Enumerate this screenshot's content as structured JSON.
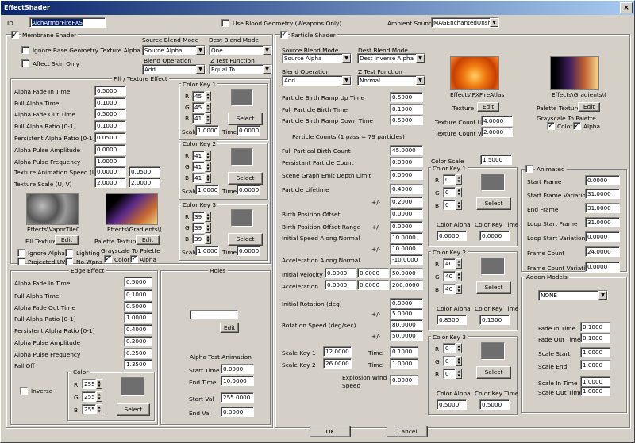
{
  "window": {
    "title": "EffectShader",
    "close": "×"
  },
  "top": {
    "id_label": "ID",
    "id_value": "AlchArmorFireFXS",
    "blood_label": "Use Blood Geometry (Weapons Only)",
    "ambient_label": "Ambient Sound",
    "ambient_value": "MAGEnchantedUnshea"
  },
  "membrane": {
    "title": "Membrane Shader",
    "ignore_base": "Ignore Base Geometry Texture Alpha",
    "affect_skin": "Affect Skin Only",
    "src_blend_label": "Source Blend Mode",
    "src_blend": "Source Alpha",
    "dst_blend_label": "Dest Blend Mode",
    "dst_blend": "One",
    "blend_op_label": "Blend Operation",
    "blend_op": "Add",
    "ztest_label": "Z Test Function",
    "ztest": "Equal To"
  },
  "fill": {
    "title": "Fill / Texture Effect",
    "rows": [
      {
        "label": "Alpha Fade In Time",
        "v": "0.5000"
      },
      {
        "label": "Full Alpha Time",
        "v": "0.1000"
      },
      {
        "label": "Alpha Fade Out Time",
        "v": "0.5000"
      },
      {
        "label": "Full Alpha Ratio [0-1]",
        "v": "0.1000"
      },
      {
        "label": "Persistent Alpha Ratio [0-1]",
        "v": "0.0500"
      },
      {
        "label": "Alpha Pulse Amplitude",
        "v": "0.0000"
      },
      {
        "label": "Alpha Pulse Frequency",
        "v": "1.0000"
      }
    ],
    "tex_anim_label": "Texture Animation Speed (U, V)",
    "tex_anim_u": "0.0000",
    "tex_anim_v": "0.0500",
    "tex_scale_label": "Texture Scale (U, V)",
    "tex_scale_u": "2.0000",
    "tex_scale_v": "2.0000",
    "fill_tex_path": "Effects\\VaporTile0",
    "pal_tex_path": "Effects\\Gradients\\(",
    "fill_tex_label": "Fill Texture",
    "pal_tex_label": "Palette Texture",
    "edit": "Edit",
    "ignore_alpha": "Ignore Alpha",
    "lighting": "Lighting",
    "projected_uvs": "Projected UVs",
    "no_wpns": "No Wpns",
    "grayscale_label": "Grayscale To Palette",
    "color": "Color",
    "alpha": "Alpha"
  },
  "ck1": {
    "title": "Color Key 1",
    "r": "45",
    "g": "45",
    "b": "41",
    "scale": "1.0000",
    "time": "0.0000"
  },
  "ck2": {
    "title": "Color Key 2",
    "r": "41",
    "g": "41",
    "b": "41",
    "scale": "1.0000",
    "time": "0.0000"
  },
  "ck3": {
    "title": "Color Key 3",
    "r": "39",
    "g": "39",
    "b": "39",
    "scale": "1.0000",
    "time": "0.0000"
  },
  "labels": {
    "r": "R",
    "g": "G",
    "b": "B",
    "scale": "Scale",
    "time": "Time",
    "select": "Select",
    "pm": "+/-"
  },
  "edge": {
    "title": "Edge Effect",
    "rows": [
      {
        "label": "Alpha Fade In Time",
        "v": "0.5000"
      },
      {
        "label": "Full Alpha Time",
        "v": "0.1000"
      },
      {
        "label": "Alpha Fade Out Time",
        "v": "0.5000"
      },
      {
        "label": "Full Alpha Ratio [0-1]",
        "v": "1.0000"
      },
      {
        "label": "Persistent Alpha Ratio [0-1]",
        "v": "0.4000"
      },
      {
        "label": "Alpha Pulse Amplitude",
        "v": "0.2000"
      },
      {
        "label": "Alpha Pulse Frequency",
        "v": "0.2500"
      },
      {
        "label": "Fall Off",
        "v": "1.3500"
      }
    ],
    "color": "Color",
    "inverse": "Inverse",
    "r": "255",
    "g": "255",
    "b": "255"
  },
  "holes": {
    "title": "Holes",
    "edit": "Edit",
    "ata": "Alpha Test Animation",
    "start_time_l": "Start Time",
    "start_time": "0.0000",
    "end_time_l": "End Time",
    "end_time": "10.0000",
    "start_val_l": "Start Val",
    "start_val": "255.0000",
    "end_val_l": "End Val",
    "end_val": "0.0000"
  },
  "particle": {
    "title": "Particle Shader",
    "src_blend_label": "Source Blend Mode",
    "src_blend": "Source Alpha",
    "dst_blend_label": "Dest Blend Mode",
    "dst_blend": "Dest Inverse Alpha",
    "blend_op_label": "Blend Operation",
    "blend_op": "Add",
    "ztest_label": "Z Test Function",
    "ztest": "Normal",
    "tex_path": "Effects\\FXFireAtlas",
    "pal_path": "Effects\\Gradients\\(",
    "tex_label": "Texture",
    "pal_label": "Palette Texture",
    "edit": "Edit",
    "grayscale_label": "Grayscale To Palette",
    "color": "Color",
    "alpha": "Alpha",
    "tcu_label": "Texture Count U",
    "tcu": "4.0000",
    "tcv_label": "Texture Count V",
    "tcv": "2.0000",
    "ramp_up_l": "Particle Birth Ramp Up Time",
    "ramp_up": "0.5000",
    "full_birth_l": "Full Particle Birth Time",
    "full_birth": "0.1000",
    "ramp_down_l": "Particle Birth Ramp Down Time",
    "ramp_down": "0.5000",
    "counts_l": "Particle Counts (1 pass = 79 particles)",
    "full_ratio_l": "Full Partical Birth Count",
    "full_ratio": "45.0000",
    "persist_l": "Persistant Particle Count",
    "persist": "0.0000",
    "depth_l": "Scene Graph Emit Depth Limit",
    "depth": "0.0000",
    "life_l": "Particle Lifetime",
    "life": "0.4000",
    "life_pm": "0.2000",
    "bpo_l": "Birth Position Offset",
    "bpo": "0.0000",
    "bpor_l": "Birth Position Offset Range",
    "bpor": "0.0000",
    "isan_l": "Initial Speed Along Normal",
    "isan": "10.0000",
    "isan_pm": "10.0000",
    "aan_l": "Acceleration Along Normal",
    "aan": "-10.0000",
    "iv_l": "Initial Velocity",
    "iv1": "0.0000",
    "iv2": "0.0000",
    "iv3": "50.0000",
    "acc_l": "Acceleration",
    "acc1": "0.0000",
    "acc2": "0.0000",
    "acc3": "200.0000",
    "irot_l": "Initial Rotation (deg)",
    "irot": "0.0000",
    "irot_pm": "5.0000",
    "rs_l": "Rotation Speed (deg/sec)",
    "rs": "80.0000",
    "rs_pm": "50.0000",
    "sk1_l": "Scale Key 1",
    "sk1": "12.0000",
    "sk1t": "0.1000",
    "sk2_l": "Scale Key 2",
    "sk2": "26.0000",
    "sk2t": "1.0000",
    "time": "Time",
    "expl_l": "Explosion Wind Speed",
    "expl": "0.0000",
    "cscale_l": "Color Scale",
    "cscale": "1.5000"
  },
  "pck1": {
    "title": "Color Key 1",
    "r": "0",
    "g": "0",
    "b": "0",
    "alpha": "0.0000",
    "time": "0.0000"
  },
  "pck2": {
    "title": "Color Key 2",
    "r": "40",
    "g": "40",
    "b": "40",
    "alpha": "0.8500",
    "time": "0.1500"
  },
  "pck3": {
    "title": "Color Key 3",
    "r": "0",
    "g": "0",
    "b": "0",
    "alpha": "0.5000",
    "time": "0.5000"
  },
  "plabels": {
    "calpha": "Color Alpha",
    "ckt": "Color Key Time"
  },
  "animated": {
    "title": "Animated",
    "rows": [
      {
        "label": "Start Frame",
        "v": "0.0000"
      },
      {
        "label": "Start Frame Variation",
        "v": "31.0000"
      },
      {
        "label": "End Frame",
        "v": "31.0000"
      },
      {
        "label": "Loop Start Frame",
        "v": "31.0000"
      },
      {
        "label": "Loop Start Variation",
        "v": "0.0000"
      },
      {
        "label": "Frame Count",
        "v": "24.0000"
      },
      {
        "label": "Frame Count Variation",
        "v": "0.0000"
      }
    ]
  },
  "addon": {
    "title": "Addon Models",
    "model": "NONE",
    "fit_l": "Fade In Time",
    "fit": "0.1000",
    "fot_l": "Fade Out Time",
    "fot": "0.1000",
    "ss_l": "Scale Start",
    "ss": "1.0000",
    "se_l": "Scale End",
    "se": "1.0000",
    "sit_l": "Scale In Time",
    "sit": "1.0000",
    "sot_l": "Scale Out Time",
    "sot": "1.0000"
  },
  "footer": {
    "ok": "OK",
    "cancel": "Cancel"
  },
  "colors": {
    "title_start": "#0a246a",
    "title_end": "#a6caf0",
    "face": "#d4d0c8",
    "swatch": "#6e6e6e"
  }
}
